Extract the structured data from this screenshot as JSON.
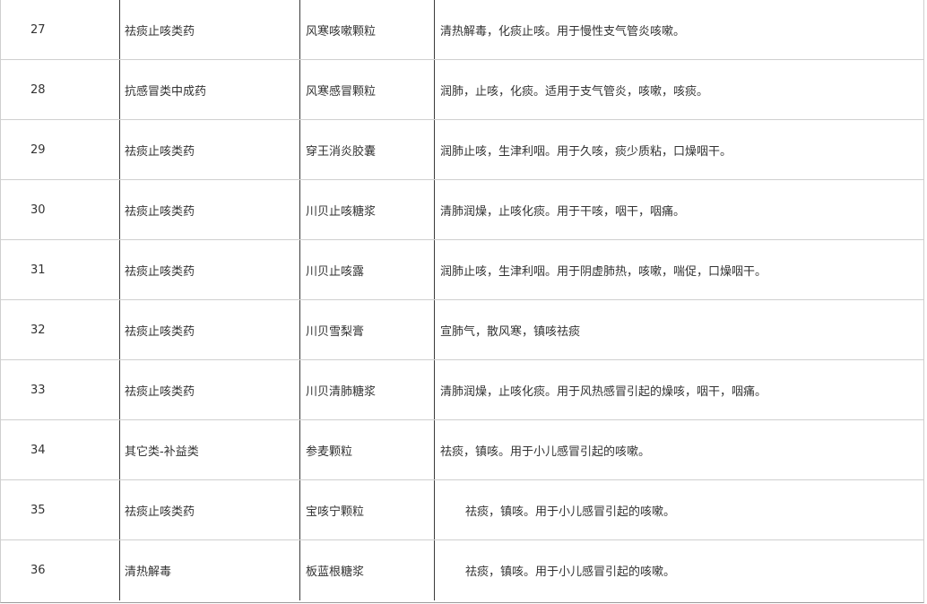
{
  "rows": [
    {
      "num": "27",
      "category": "祛痰止咳类药",
      "name": "风寒咳嗽颗粒",
      "desc": "清热解毒，化痰止咳。用于慢性支气管炎咳嗽。",
      "indent": false
    },
    {
      "num": "28",
      "category": "抗感冒类中成药",
      "name": "风寒感冒颗粒",
      "desc": "润肺，止咳，化痰。适用于支气管炎，咳嗽，咳痰。",
      "indent": false
    },
    {
      "num": "29",
      "category": "祛痰止咳类药",
      "name": "穿王消炎胶囊",
      "desc": "润肺止咳，生津利咽。用于久咳，痰少质粘，口燥咽干。",
      "indent": false
    },
    {
      "num": "30",
      "category": "祛痰止咳类药",
      "name": "川贝止咳糖浆",
      "desc": "清肺润燥，止咳化痰。用于干咳，咽干，咽痛。",
      "indent": false
    },
    {
      "num": "31",
      "category": "祛痰止咳类药",
      "name": "川贝止咳露",
      "desc": "润肺止咳，生津利咽。用于阴虚肺热，咳嗽，喘促，口燥咽干。",
      "indent": false
    },
    {
      "num": "32",
      "category": "祛痰止咳类药",
      "name": "川贝雪梨膏",
      "desc": "宣肺气，散风寒，镇咳祛痰",
      "indent": false
    },
    {
      "num": "33",
      "category": "祛痰止咳类药",
      "name": "川贝清肺糖浆",
      "desc": "清肺润燥，止咳化痰。用于风热感冒引起的燥咳，咽干，咽痛。",
      "indent": false
    },
    {
      "num": "34",
      "category": "其它类-补益类",
      "name": "参麦颗粒",
      "desc": "祛痰，镇咳。用于小儿感冒引起的咳嗽。",
      "indent": false
    },
    {
      "num": "35",
      "category": "祛痰止咳类药",
      "name": "宝咳宁颗粒",
      "desc": "祛痰，镇咳。用于小儿感冒引起的咳嗽。",
      "indent": true
    },
    {
      "num": "36",
      "category": "清热解毒",
      "name": "板蓝根糖浆",
      "desc": "祛痰，镇咳。用于小儿感冒引起的咳嗽。",
      "indent": true
    }
  ]
}
